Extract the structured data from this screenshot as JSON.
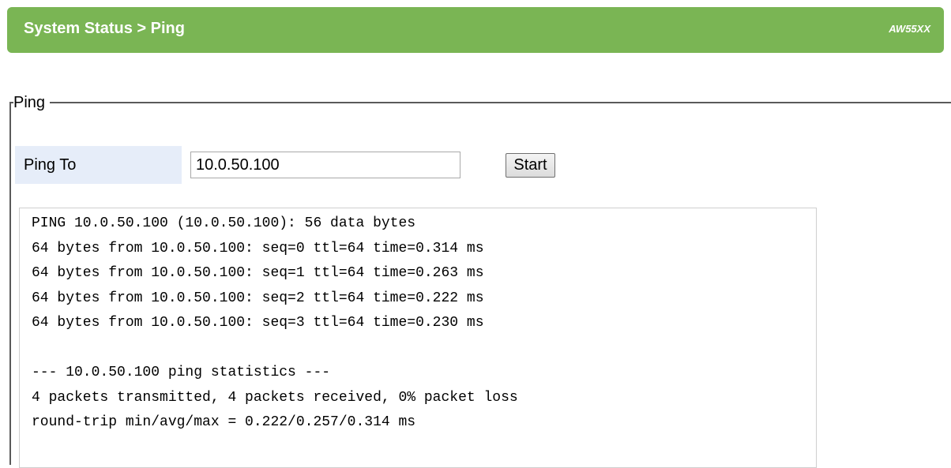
{
  "header": {
    "title": "System Status > Ping",
    "model": "AW55XX",
    "color": "#7ab554"
  },
  "ping_section": {
    "legend": "Ping",
    "ping_to_label": "Ping To",
    "ping_to_value": "10.0.50.100",
    "start_label": "Start",
    "row_color": "#e6edf9"
  },
  "output": {
    "lines": [
      "PING 10.0.50.100 (10.0.50.100): 56 data bytes",
      "64 bytes from 10.0.50.100: seq=0 ttl=64 time=0.314 ms",
      "64 bytes from 10.0.50.100: seq=1 ttl=64 time=0.263 ms",
      "64 bytes from 10.0.50.100: seq=2 ttl=64 time=0.222 ms",
      "64 bytes from 10.0.50.100: seq=3 ttl=64 time=0.230 ms",
      "",
      "--- 10.0.50.100 ping statistics ---",
      "4 packets transmitted, 4 packets received, 0% packet loss",
      "round-trip min/avg/max = 0.222/0.257/0.314 ms"
    ]
  }
}
